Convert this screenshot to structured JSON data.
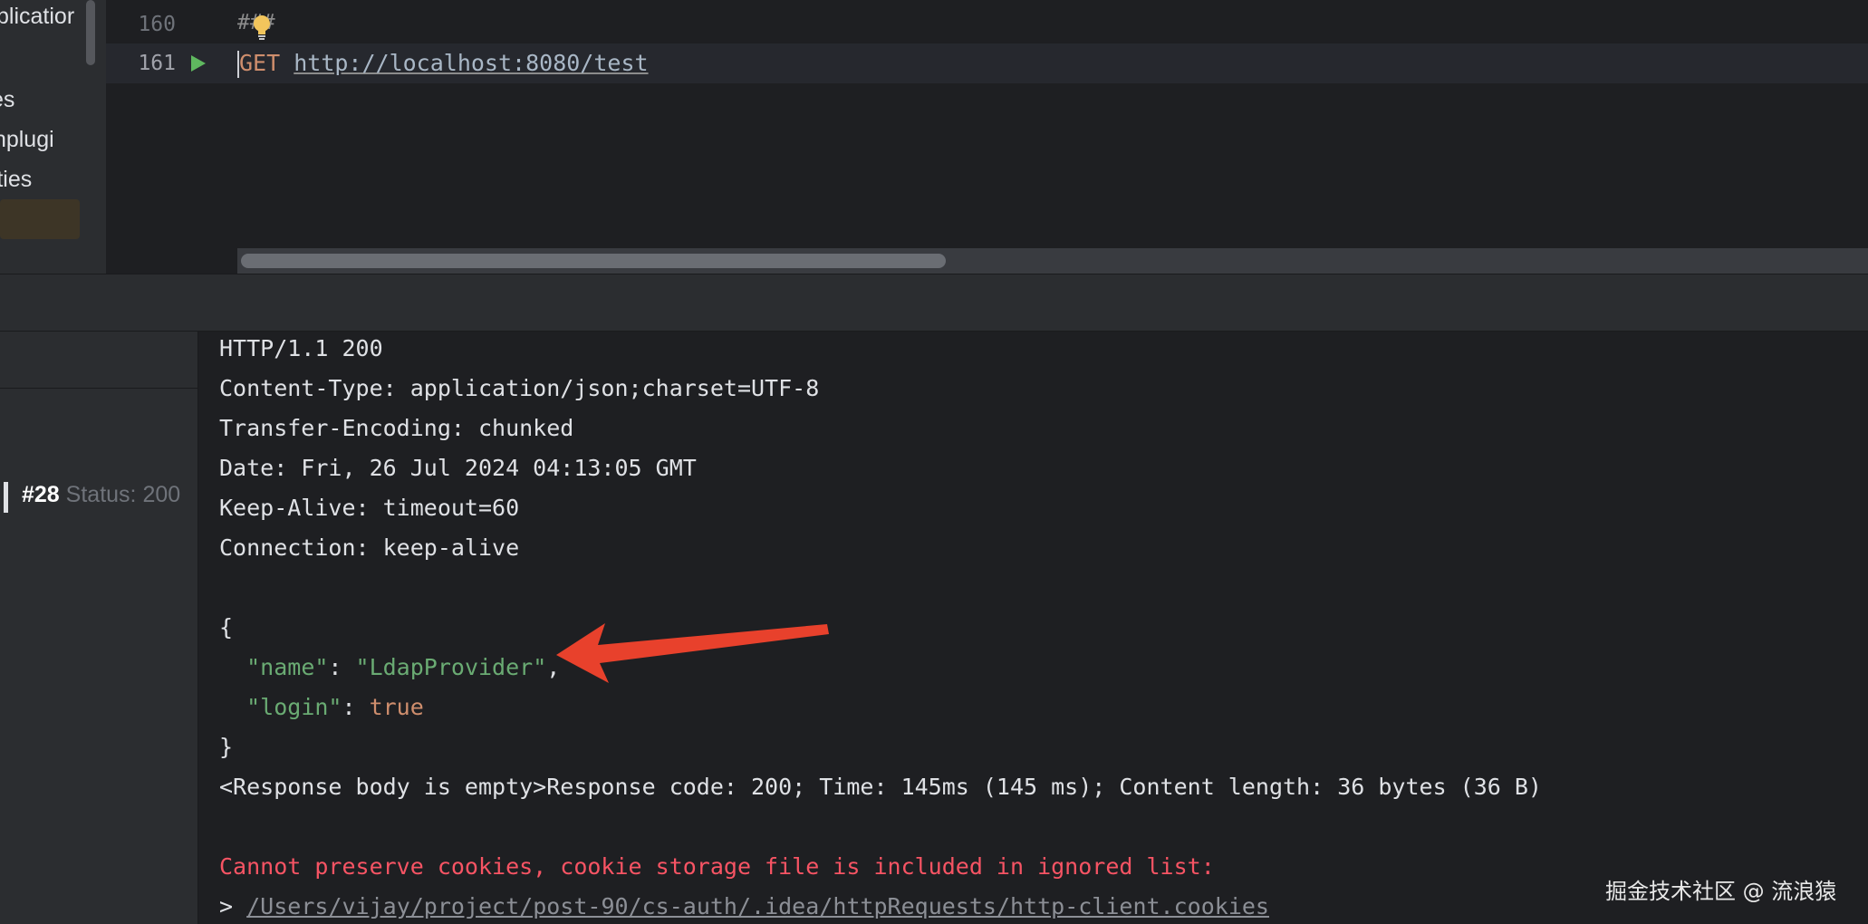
{
  "sidebar": {
    "items": [
      "plicatior",
      "es",
      "thplugi",
      "rties"
    ]
  },
  "editor": {
    "lines": [
      {
        "number": "160",
        "text": "###"
      },
      {
        "number": "161",
        "method": "GET",
        "url": "http://localhost:8080/test"
      }
    ]
  },
  "history": {
    "number": "#28",
    "status": "Status: 200"
  },
  "response": {
    "headers": [
      "HTTP/1.1 200",
      "Content-Type: application/json;charset=UTF-8",
      "Transfer-Encoding: chunked",
      "Date: Fri, 26 Jul 2024 04:13:05 GMT",
      "Keep-Alive: timeout=60",
      "Connection: keep-alive"
    ],
    "body": {
      "open_brace": "{",
      "close_brace": "}",
      "name_key": "\"name\"",
      "name_value": "\"LdapProvider\"",
      "login_key": "\"login\"",
      "login_value": "true"
    },
    "summary": "<Response body is empty>Response code: 200; Time: 145ms (145 ms); Content length: 36 bytes (36 B)",
    "error": "Cannot preserve cookies, cookie storage file is included in ignored list:",
    "prompt": ">",
    "cookie_path": "/Users/vijay/project/post-90/cs-auth/.idea/httpRequests/http-client.cookies"
  },
  "colors": {
    "background": "#1e1f22",
    "panel": "#2b2d30",
    "json_string": "#6aab73",
    "keyword": "#cf8e6d",
    "error": "#f75464",
    "annotation_arrow": "#e8412c"
  },
  "icons": {
    "run": "run-icon",
    "bulb": "bulb-icon",
    "annotation": "arrow-annotation"
  },
  "watermark": "掘金技术社区 @ 流浪猿"
}
